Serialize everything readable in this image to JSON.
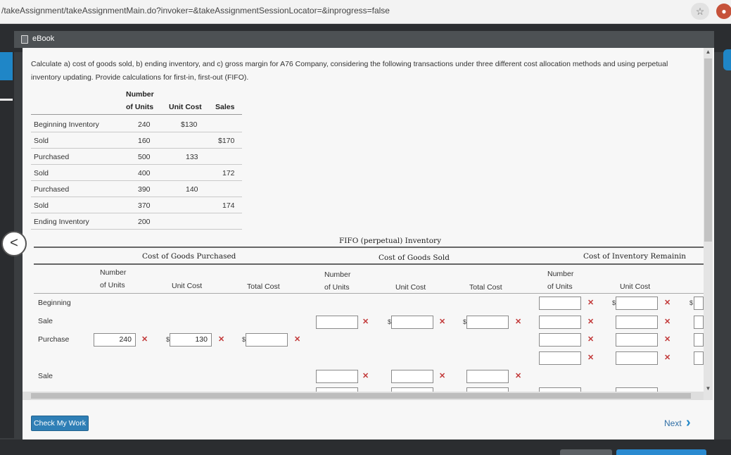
{
  "browser": {
    "url": "/takeAssignment/takeAssignmentMain.do?invoker=&takeAssignmentSessionLocator=&inprogress=false",
    "star_icon": "star-icon",
    "extension_icon": "extension-icon"
  },
  "ebook": {
    "label": "eBook",
    "icon": "book-icon"
  },
  "problem": {
    "text": "Calculate a) cost of goods sold, b) ending inventory, and c) gross margin for A76 Company, considering the following transactions under three different cost allocation methods and using perpetual inventory updating. Provide calculations for first-in, first-out (FIFO)."
  },
  "transactions": {
    "headers": {
      "number_line1": "Number",
      "number_line2": "of Units",
      "unit_cost": "Unit Cost",
      "sales": "Sales"
    },
    "rows": [
      {
        "label": "Beginning Inventory",
        "units": "240",
        "unit_cost": "$130",
        "sales": ""
      },
      {
        "label": "Sold",
        "units": "160",
        "unit_cost": "",
        "sales": "$170"
      },
      {
        "label": "Purchased",
        "units": "500",
        "unit_cost": "133",
        "sales": ""
      },
      {
        "label": "Sold",
        "units": "400",
        "unit_cost": "",
        "sales": "172"
      },
      {
        "label": "Purchased",
        "units": "390",
        "unit_cost": "140",
        "sales": ""
      },
      {
        "label": "Sold",
        "units": "370",
        "unit_cost": "",
        "sales": "174"
      },
      {
        "label": "Ending Inventory",
        "units": "200",
        "unit_cost": "",
        "sales": ""
      }
    ]
  },
  "fifo": {
    "title": "FIFO (perpetual) Inventory",
    "groups": {
      "purchased": "Cost of Goods Purchased",
      "sold": "Cost of Goods Sold",
      "remaining": "Cost of Inventory Remainin"
    },
    "col_headers": {
      "number_line1": "Number",
      "number_line2": "of Units",
      "unit_cost": "Unit Cost",
      "total_cost": "Total Cost"
    },
    "row_labels": [
      "Beginning",
      "Sale",
      "Purchase",
      "Sale"
    ],
    "purchase_inputs": {
      "units": "240",
      "unit_cost": "130",
      "total_cost": ""
    },
    "dollar": "$",
    "wrong_mark": "✕"
  },
  "footer": {
    "check_button": "Check My Work",
    "next_label": "Next",
    "next_icon": "chevron-right-icon"
  },
  "nav": {
    "back_icon": "chevron-left-icon"
  },
  "colors": {
    "accent": "#1f86c7",
    "error": "#c23838",
    "button": "#2f7fb6"
  }
}
